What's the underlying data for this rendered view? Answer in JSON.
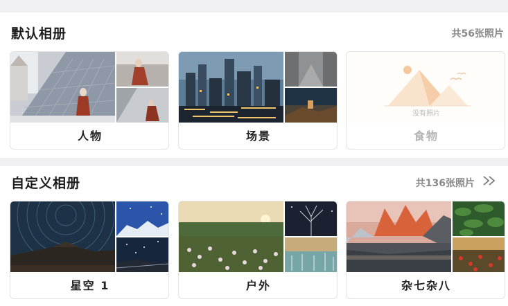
{
  "default_section": {
    "title": "默认相册",
    "count": "共56张照片",
    "albums": [
      {
        "name": "人物"
      },
      {
        "name": "场景"
      },
      {
        "name": "食物",
        "empty_text": "没有照片"
      }
    ]
  },
  "custom_section": {
    "title": "自定义相册",
    "count": "共136张照片",
    "more_icon": "double-chevron-right-icon",
    "albums": [
      {
        "name": "星空 1"
      },
      {
        "name": "户外"
      },
      {
        "name": "杂七杂八"
      }
    ]
  },
  "colors": {
    "background": "#ffffff",
    "divider": "#f0f0f2",
    "muted_text": "#8a8a8a",
    "empty_accent": "#f5c9a0"
  }
}
